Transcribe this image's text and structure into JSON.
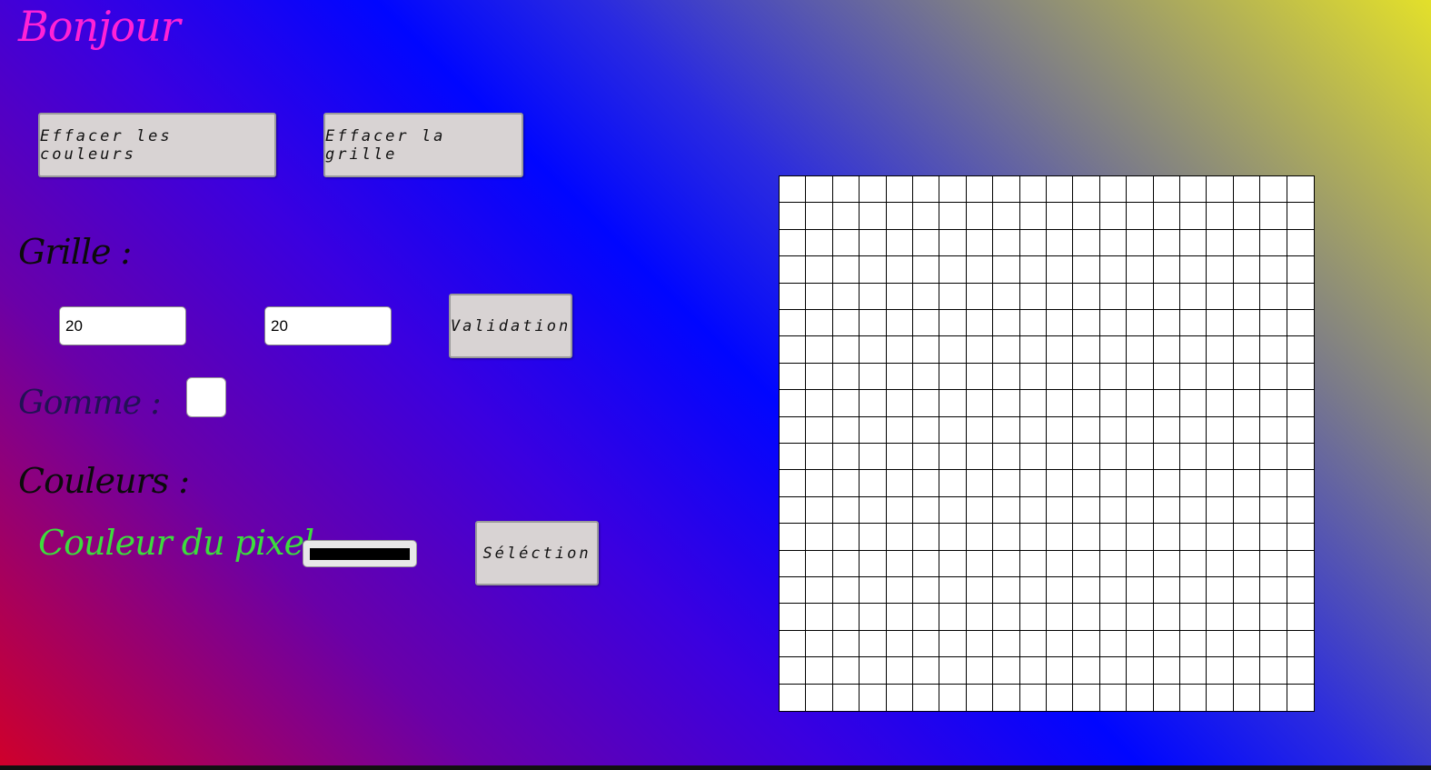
{
  "header": {
    "title": "Bonjour"
  },
  "toolbar": {
    "clear_colors_label": "Effacer les couleurs",
    "clear_grid_label": "Effacer la grille"
  },
  "grid_section": {
    "label": "Grille :",
    "rows_value": "20",
    "cols_value": "20",
    "validate_label": "Validation"
  },
  "eraser": {
    "label": "Gomme :",
    "checked": false
  },
  "colors_section": {
    "label": "Couleurs :",
    "pixel_color_label": "Couleur du pixel",
    "pixel_color_value": "#000000",
    "select_label": "Séléction"
  },
  "canvas": {
    "rows": 20,
    "cols": 20,
    "cell_color": "#ffffff",
    "line_color": "#000000"
  },
  "colors": {
    "title": "#ff22d6",
    "sub_label": "#3ddc3d",
    "button_bg": "#d8d3d3"
  }
}
